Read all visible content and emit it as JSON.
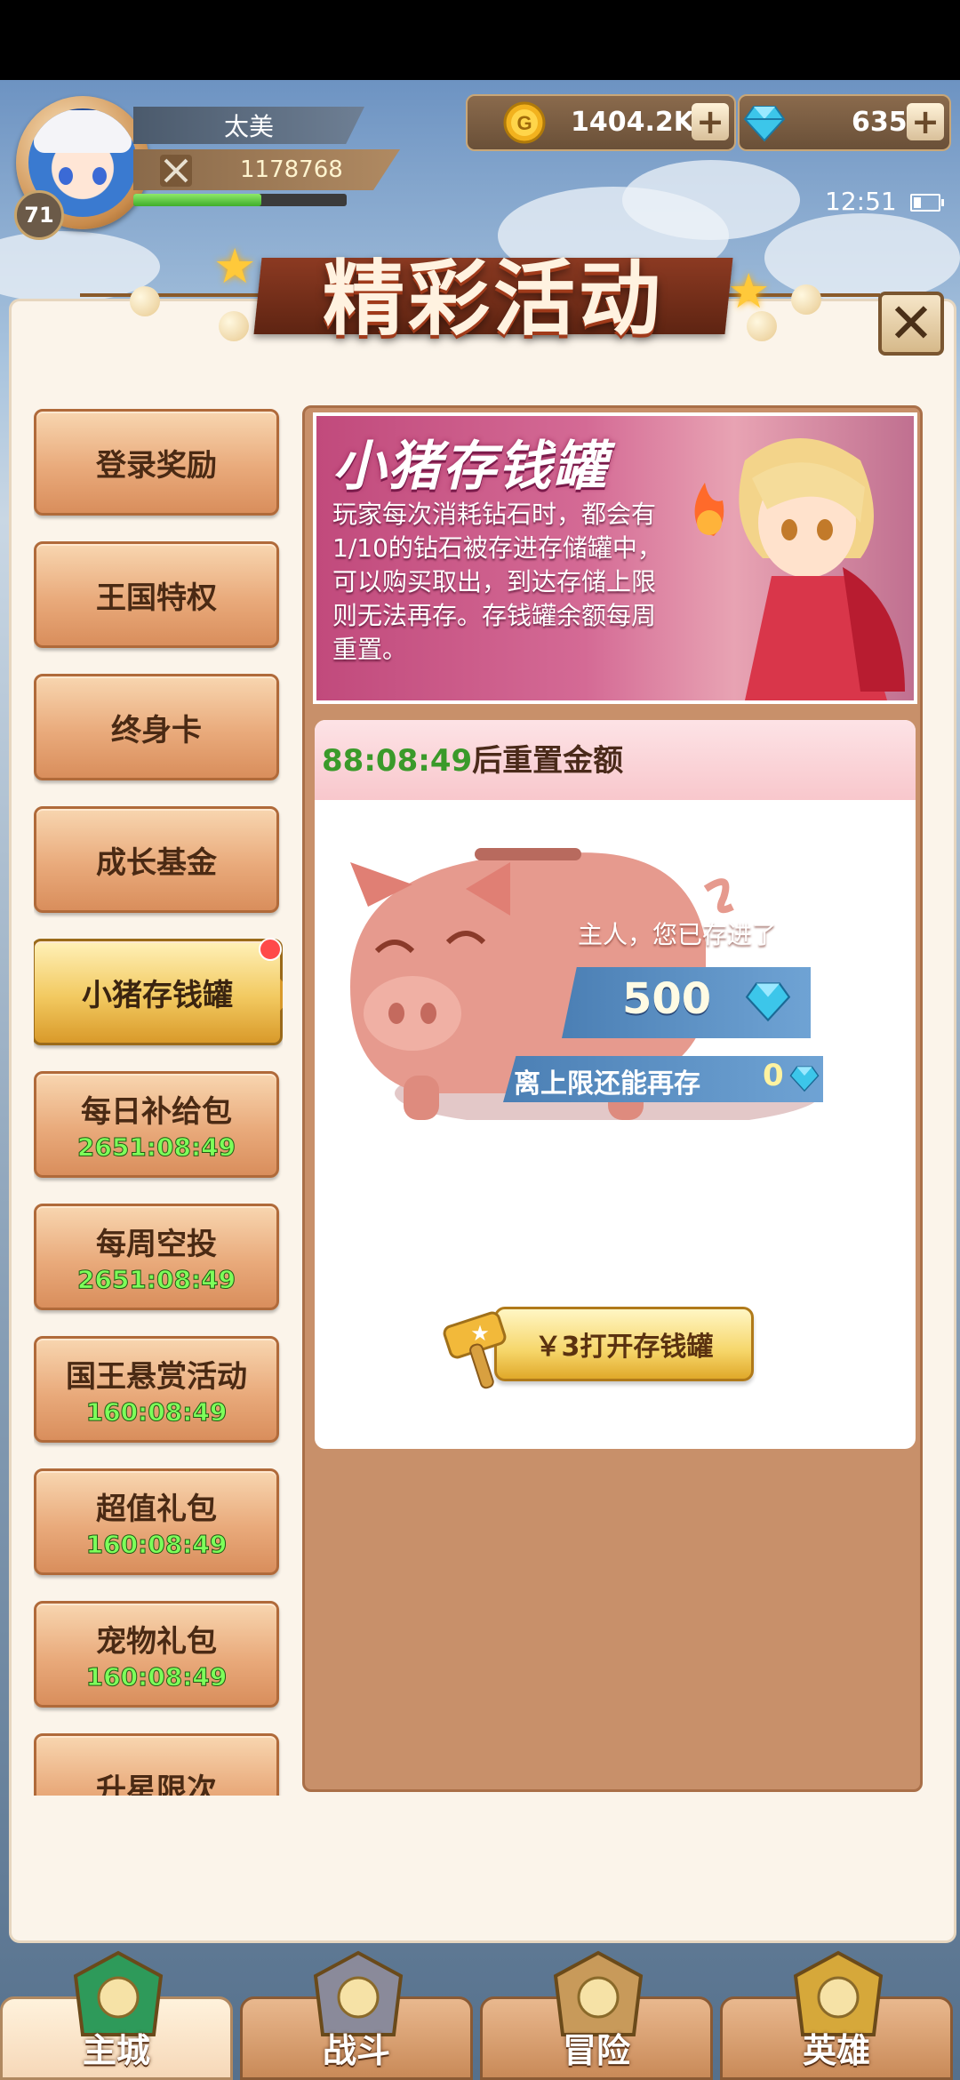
{
  "player": {
    "name": "太美",
    "level": "71",
    "power": "1178768",
    "exp_fraction": 0.6
  },
  "resources": {
    "gold": "1404.2K",
    "gems": "635"
  },
  "status": {
    "time": "12:51"
  },
  "title": "精彩活动",
  "menu": [
    {
      "label": "登录奖励",
      "timer": ""
    },
    {
      "label": "王国特权",
      "timer": ""
    },
    {
      "label": "终身卡",
      "timer": ""
    },
    {
      "label": "成长基金",
      "timer": ""
    },
    {
      "label": "小猪存钱罐",
      "timer": "",
      "active": true
    },
    {
      "label": "每日补给包",
      "timer": "2651:08:49"
    },
    {
      "label": "每周空投",
      "timer": "2651:08:49"
    },
    {
      "label": "国王悬赏活动",
      "timer": "160:08:49"
    },
    {
      "label": "超值礼包",
      "timer": "160:08:49"
    },
    {
      "label": "宠物礼包",
      "timer": "160:08:49"
    },
    {
      "label": "升星限次",
      "timer": ""
    }
  ],
  "piggy": {
    "banner_title": "小猪存钱罐",
    "description": "玩家每次消耗钻石时，都会有1/10的钻石被存进存储罐中，可以购买取出，到达存储上限则无法再存。存钱罐余额每周重置。",
    "reset_timer": "88:08:49",
    "reset_suffix": "后重置金额",
    "saved_label": "主人，您已存进了",
    "saved_amount": "500",
    "cap_label": "离上限还能再存",
    "cap_amount": "0",
    "open_button": "￥3打开存钱罐"
  },
  "nav": [
    {
      "label": "主城",
      "active": true
    },
    {
      "label": "战斗"
    },
    {
      "label": "冒险"
    },
    {
      "label": "英雄"
    }
  ]
}
